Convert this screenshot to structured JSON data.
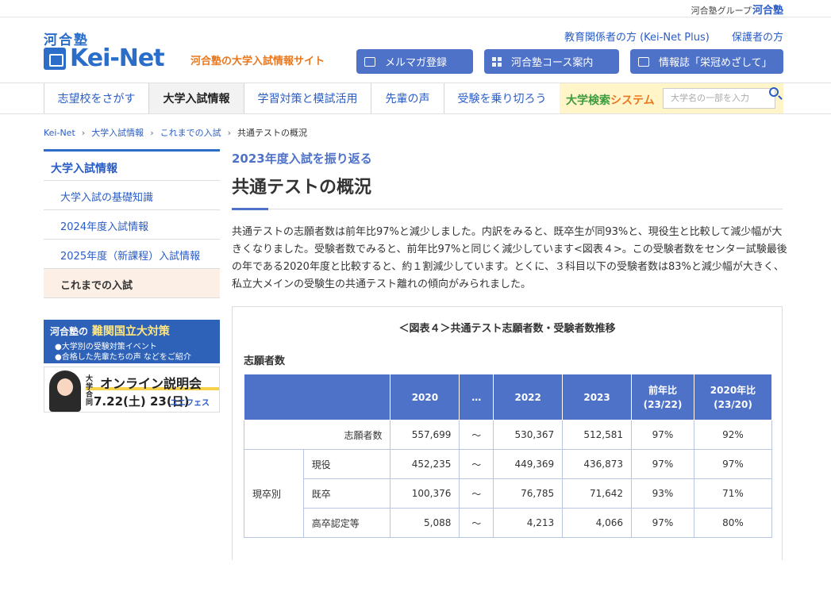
{
  "group_bar": {
    "text": "河合塾グループ",
    "logo": "河合塾"
  },
  "header": {
    "brand_small": "河合塾",
    "logo_text": "Kei-Net",
    "tagline": "河合塾の大学入試情報サイト",
    "util_links": [
      "教育関係者の方 (Kei-Net Plus)",
      "保護者の方"
    ],
    "buttons": [
      "メルマガ登録",
      "河合塾コース案内",
      "情報誌「栄冠めざして」"
    ]
  },
  "nav": {
    "items": [
      "志望校をさがす",
      "大学入試情報",
      "学習対策と模試活用",
      "先輩の声",
      "受験を乗り切ろう"
    ],
    "search_label_a": "大学検索",
    "search_label_b": "システム",
    "search_placeholder": "大学名の一部を入力"
  },
  "breadcrumb": [
    "Kei-Net",
    "大学入試情報",
    "これまでの入試",
    "共通テストの概況"
  ],
  "sidebar": {
    "head": "大学入試情報",
    "items": [
      "大学入試の基礎知識",
      "2024年度入試情報",
      "2025年度（新課程）入試情報",
      "これまでの入試"
    ]
  },
  "banners": {
    "b1_brand": "河合塾の",
    "b1_title": "難関国立大対策",
    "b1_line1": "●大学別の受験対策イベント",
    "b1_line2": "●合格した先輩たちの声 などをご紹介",
    "b2_small": "大学合同",
    "b2_title": "オンライン説明会",
    "b2_dates": "7.22(土) 23(日)",
    "b2_brand": "ユニフェス"
  },
  "main": {
    "subtitle": "2023年度入試を振り返る",
    "title": "共通テストの概況",
    "paragraph": "共通テストの志願者数は前年比97%と減少しました。内訳をみると、既卒生が同93%と、現役生と比較して減少幅が大きくなりました。受験者数でみると、前年比97%と同じく減少しています<図表４>。この受験者数をセンター試験最後の年である2020年度と比較すると、約１割減少しています。とくに、３科目以下の受験者数は83%と減少幅が大きく、私立大メインの受験生の共通テスト離れの傾向がみられました。",
    "figure_title": "＜図表４＞共通テスト志願者数・受験者数推移",
    "table_label": "志願者数"
  },
  "chart_data": {
    "type": "table",
    "title": "＜図表４＞共通テスト志願者数・受験者数推移",
    "subtitle": "志願者数",
    "headers": [
      "2020",
      "…",
      "2022",
      "2023",
      "前年比 (23/22)",
      "2020年比 (23/20)"
    ],
    "rows": [
      {
        "group": "",
        "label": "志願者数",
        "values": [
          "557,699",
          "〜",
          "530,367",
          "512,581",
          "97%",
          "92%"
        ]
      },
      {
        "group": "現卒別",
        "label": "現役",
        "values": [
          "452,235",
          "〜",
          "449,369",
          "436,873",
          "97%",
          "97%"
        ]
      },
      {
        "group": "現卒別",
        "label": "既卒",
        "values": [
          "100,376",
          "〜",
          "76,785",
          "71,642",
          "93%",
          "71%"
        ]
      },
      {
        "group": "現卒別",
        "label": "高卒認定等",
        "values": [
          "5,088",
          "〜",
          "4,213",
          "4,066",
          "97%",
          "80%"
        ]
      }
    ]
  },
  "colors": {
    "accent": "#4f72c9",
    "brand": "#2a6ec9",
    "orange": "#e8781f"
  }
}
